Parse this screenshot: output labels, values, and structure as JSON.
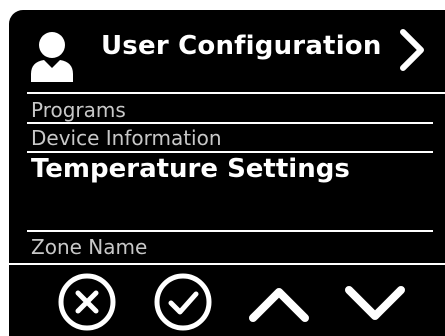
{
  "header": {
    "title": "User Configuration",
    "user_icon": "user-icon",
    "next_icon": "chevron-right-icon"
  },
  "menu": {
    "items": [
      {
        "label": "Programs",
        "state": "dim"
      },
      {
        "label": "Device Information",
        "state": "dim"
      },
      {
        "label": "Temperature Settings",
        "state": "active"
      },
      {
        "label": "Zone Name",
        "state": "dim"
      }
    ]
  },
  "controls": {
    "cancel_icon": "cancel-icon",
    "confirm_icon": "check-icon",
    "up_icon": "chevron-up-icon",
    "down_icon": "chevron-down-icon"
  },
  "colors": {
    "background": "#000000",
    "foreground": "#ffffff",
    "dim_text": "#c8c8c8"
  }
}
